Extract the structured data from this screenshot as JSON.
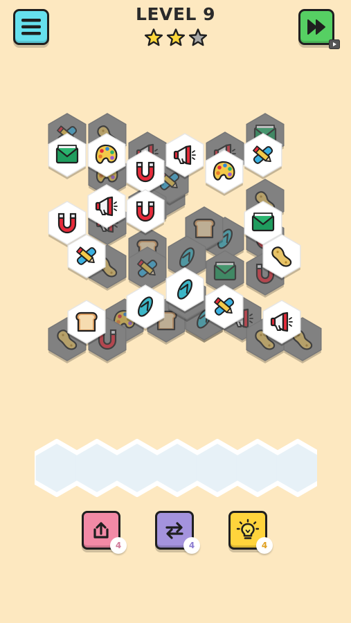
{
  "header": {
    "level_label": "LEVEL 9",
    "stars_earned": 2,
    "stars_total": 3
  },
  "buttons": {
    "menu_icon": "hamburger-menu-icon",
    "skip_icon": "fast-forward-icon",
    "skip_badge_icon": "video-ad-icon"
  },
  "tray": {
    "slots": 7,
    "filled": 0
  },
  "powerups": [
    {
      "name": "undo",
      "icon": "undo-arrow-icon",
      "count": "4",
      "color": "#f28aa6"
    },
    {
      "name": "shuffle",
      "icon": "shuffle-arrows-icon",
      "count": "4",
      "color": "#a493dd"
    },
    {
      "name": "hint",
      "icon": "lightbulb-icon",
      "count": "4",
      "color": "#ffd43c"
    }
  ],
  "tile_types": [
    "magnet",
    "megaphone",
    "envelope",
    "palette",
    "pencil-bandage",
    "flip-flop",
    "toast",
    "bean"
  ],
  "tiles": [
    {
      "icon": "pencil-bandage",
      "layer": 0
    },
    {
      "icon": "bean",
      "layer": 0
    },
    {
      "icon": "megaphone",
      "layer": 0
    },
    {
      "icon": "envelope",
      "layer": 0
    },
    {
      "icon": "palette",
      "layer": 0
    },
    {
      "icon": "pencil-bandage",
      "layer": 0
    },
    {
      "icon": "megaphone",
      "layer": 0
    },
    {
      "icon": "bean",
      "layer": 0
    },
    {
      "icon": "megaphone",
      "layer": 0
    },
    {
      "icon": "toast",
      "layer": 0
    },
    {
      "icon": "pencil-bandage",
      "layer": 0
    },
    {
      "icon": "flip-flop",
      "layer": 0
    },
    {
      "icon": "pencil-bandage",
      "layer": 0
    },
    {
      "icon": "toast",
      "layer": 0
    },
    {
      "icon": "flip-flop",
      "layer": 0
    },
    {
      "icon": "bean",
      "layer": 0
    },
    {
      "icon": "magnet",
      "layer": 0
    },
    {
      "icon": "toast",
      "layer": 0
    },
    {
      "icon": "palette",
      "layer": 0
    },
    {
      "icon": "bean",
      "layer": 0
    },
    {
      "icon": "magnet",
      "layer": 0
    },
    {
      "icon": "toast",
      "layer": 0
    },
    {
      "icon": "flip-flop",
      "layer": 0
    },
    {
      "icon": "magnet",
      "layer": 0
    },
    {
      "icon": "envelope",
      "layer": 0
    },
    {
      "icon": "flip-flop",
      "layer": 0
    },
    {
      "icon": "megaphone",
      "layer": 0
    },
    {
      "icon": "bean",
      "layer": 0
    },
    {
      "icon": "bean",
      "layer": 0
    },
    {
      "icon": "bean",
      "layer": 0
    },
    {
      "icon": "envelope",
      "layer": 1
    },
    {
      "icon": "palette",
      "layer": 1
    },
    {
      "icon": "magnet",
      "layer": 1
    },
    {
      "icon": "megaphone",
      "layer": 1
    },
    {
      "icon": "palette",
      "layer": 1
    },
    {
      "icon": "pencil-bandage",
      "layer": 1
    },
    {
      "icon": "magnet",
      "layer": 1
    },
    {
      "icon": "megaphone",
      "layer": 1
    },
    {
      "icon": "magnet",
      "layer": 1
    },
    {
      "icon": "envelope",
      "layer": 1
    },
    {
      "icon": "pencil-bandage",
      "layer": 1
    },
    {
      "icon": "bean",
      "layer": 1
    },
    {
      "icon": "flip-flop",
      "layer": 1
    },
    {
      "icon": "flip-flop",
      "layer": 1
    },
    {
      "icon": "toast",
      "layer": 1
    },
    {
      "icon": "pencil-bandage",
      "layer": 1
    },
    {
      "icon": "megaphone",
      "layer": 1
    }
  ],
  "colors": {
    "background": "#fde8c0",
    "tile_face": "#ffffff",
    "tile_blocked": "#8f8f8f",
    "tray": "#e7f1f7"
  }
}
